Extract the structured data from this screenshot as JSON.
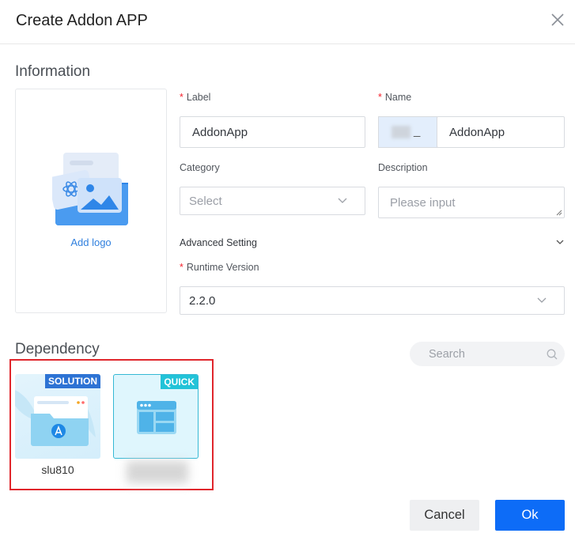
{
  "dialog": {
    "title": "Create Addon APP"
  },
  "information": {
    "section_title": "Information",
    "add_logo": "Add logo",
    "label_field": {
      "label": "Label",
      "value": "AddonApp"
    },
    "name_field": {
      "label": "Name",
      "prefix_suffix": "_",
      "value": "AddonApp"
    },
    "category": {
      "label": "Category",
      "placeholder": "Select"
    },
    "description": {
      "label": "Description",
      "placeholder": "Please input"
    },
    "advanced_setting": "Advanced Setting",
    "runtime_version": {
      "label": "Runtime Version",
      "value": "2.2.0"
    }
  },
  "dependency": {
    "section_title": "Dependency",
    "search_placeholder": "Search",
    "cards": [
      {
        "badge": "SOLUTION",
        "name": "slu810"
      },
      {
        "badge": "QUICK",
        "name": ""
      }
    ]
  },
  "footer": {
    "cancel": "Cancel",
    "ok": "Ok"
  },
  "colors": {
    "primary": "#0d6cf7",
    "required": "#f5222d",
    "highlight_border": "#e0262c",
    "link": "#2f7fde"
  }
}
